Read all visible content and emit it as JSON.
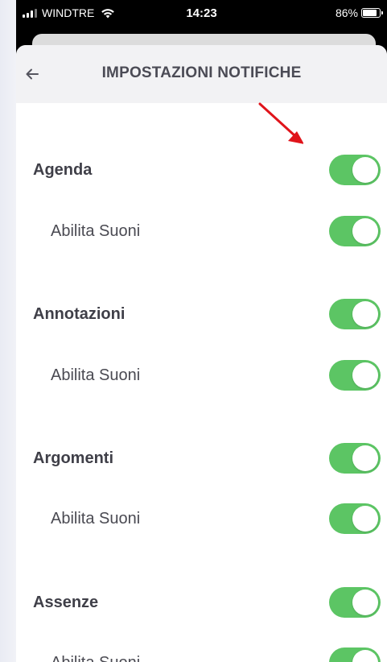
{
  "status_bar": {
    "carrier": "WINDTRE",
    "time": "14:23",
    "battery": "86%",
    "battery_level": 0.86,
    "signal_icon": "signal-bars-icon",
    "wifi_icon": "wifi-icon"
  },
  "header": {
    "title": "IMPOSTAZIONI NOTIFICHE",
    "back_icon": "arrow-left-icon"
  },
  "sections": [
    {
      "label": "Agenda",
      "enabled": true,
      "sub": {
        "label": "Abilita Suoni",
        "enabled": true
      }
    },
    {
      "label": "Annotazioni",
      "enabled": true,
      "sub": {
        "label": "Abilita Suoni",
        "enabled": true
      }
    },
    {
      "label": "Argomenti",
      "enabled": true,
      "sub": {
        "label": "Abilita Suoni",
        "enabled": true
      }
    },
    {
      "label": "Assenze",
      "enabled": true,
      "sub": {
        "label": "Abilita Suoni",
        "enabled": true
      }
    }
  ],
  "colors": {
    "toggle_on": "#5cc564",
    "annotation_arrow": "#e0141b"
  }
}
